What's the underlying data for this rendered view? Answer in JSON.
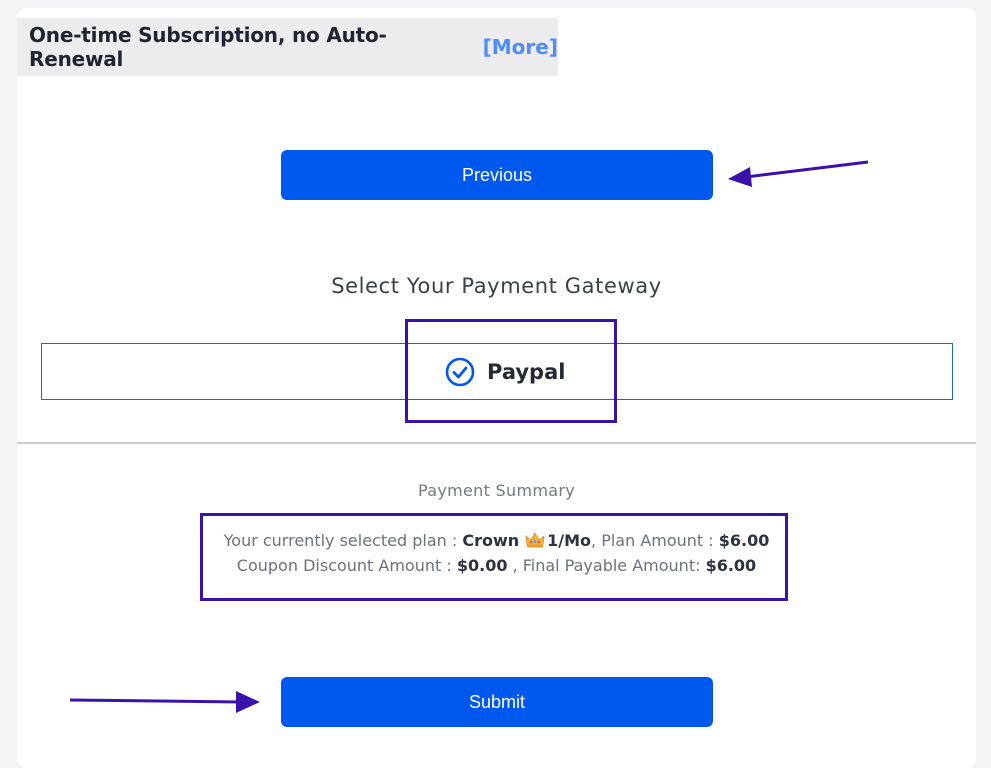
{
  "header": {
    "title": "One-time Subscription, no Auto-Renewal",
    "more_link": "[More]"
  },
  "buttons": {
    "previous_label": "Previous",
    "submit_label": "Submit"
  },
  "gateway": {
    "heading": "Select Your Payment Gateway",
    "options": [
      {
        "label": "Paypal",
        "selected": true,
        "icon": "check-circle-icon"
      }
    ]
  },
  "summary": {
    "heading": "Payment Summary",
    "selected_plan_label": "Your currently selected plan :",
    "plan_name": "Crown",
    "plan_icon": "crown-icon",
    "plan_period": "1/Mo",
    "plan_amount_label": ", Plan Amount :",
    "plan_amount": "$6.00",
    "coupon_label": "Coupon Discount Amount :",
    "coupon_amount": "$0.00",
    "final_label": ", Final Payable Amount:",
    "final_amount": "$6.00"
  },
  "colors": {
    "button_bg": "#0158ee",
    "link": "#4f8cf7",
    "annotation": "#3a12a9",
    "gateway_border": "#1a6fa3"
  }
}
